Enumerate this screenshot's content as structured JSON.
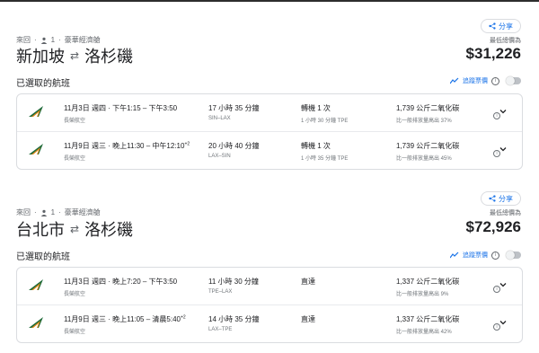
{
  "sections": [
    {
      "meta": {
        "trip": "來回",
        "passengers": "1",
        "cabin": "豪華經濟艙"
      },
      "origin": "新加坡",
      "destination": "洛杉磯",
      "share_label": "分享",
      "price_label": "最低總價為",
      "price": "$31,226",
      "selected_title": "已選取的航班",
      "track_label": "追蹤票價",
      "flights": [
        {
          "times": "11月3日 週四 · 下午1:15 – 下午3:50",
          "plus_day": "",
          "airline": "長榮航空",
          "duration": "17 小時 35 分鐘",
          "route": "SIN–LAX",
          "stops": "轉機 1 次",
          "layover": "1 小時 30 分鐘 TPE",
          "co2": "1,739 公斤二氧化碳",
          "co2_note": "比一般排放量高出 37%"
        },
        {
          "times": "11月9日 週三 · 晚上11:30 – 中午12:10",
          "plus_day": "+2",
          "airline": "長榮航空",
          "duration": "20 小時 40 分鐘",
          "route": "LAX–SIN",
          "stops": "轉機 1 次",
          "layover": "1 小時 35 分鐘 TPE",
          "co2": "1,739 公斤二氧化碳",
          "co2_note": "比一般排放量高出 45%"
        }
      ]
    },
    {
      "meta": {
        "trip": "來回",
        "passengers": "1",
        "cabin": "豪華經濟艙"
      },
      "origin": "台北市",
      "destination": "洛杉磯",
      "share_label": "分享",
      "price_label": "最低總價為",
      "price": "$72,926",
      "selected_title": "已選取的航班",
      "track_label": "追蹤票價",
      "flights": [
        {
          "times": "11月3日 週四 · 晚上7:20 – 下午3:50",
          "plus_day": "",
          "airline": "長榮航空",
          "duration": "11 小時 30 分鐘",
          "route": "TPE–LAX",
          "stops": "直達",
          "layover": "",
          "co2": "1,337 公斤二氧化碳",
          "co2_note": "比一般排放量高出 9%"
        },
        {
          "times": "11月9日 週三 · 晚上11:05 – 清晨5:40",
          "plus_day": "+2",
          "airline": "長榮航空",
          "duration": "14 小時 35 分鐘",
          "route": "LAX–TPE",
          "stops": "直達",
          "layover": "",
          "co2": "1,337 公斤二氧化碳",
          "co2_note": "比一般排放量高出 42%"
        }
      ]
    }
  ],
  "colors": {
    "accent": "#1a73e8",
    "airline_green": "#1f6b3a",
    "airline_orange": "#e88a1a"
  },
  "icons": {
    "share": "share-icon",
    "person": "person-icon",
    "swap": "swap-arrows-icon",
    "trend": "trend-chart-icon",
    "info": "info-icon",
    "chevron": "chevron-down-icon",
    "airline": "eva-air-logo"
  }
}
